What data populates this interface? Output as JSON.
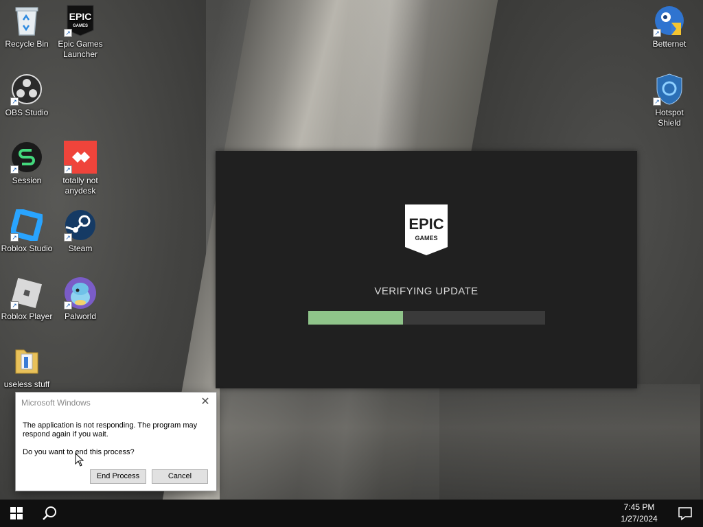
{
  "desktop": {
    "icons_left": [
      {
        "label": "Recycle Bin",
        "icon": "recycle-bin-icon"
      },
      {
        "label": "Epic Games Launcher",
        "icon": "epic-games-icon"
      },
      {
        "label": "OBS Studio",
        "icon": "obs-icon"
      },
      {
        "label": "Session",
        "icon": "session-icon"
      },
      {
        "label": "totally not anydesk",
        "icon": "anydesk-icon"
      },
      {
        "label": "Roblox Studio",
        "icon": "roblox-studio-icon"
      },
      {
        "label": "Steam",
        "icon": "steam-icon"
      },
      {
        "label": "Roblox Player",
        "icon": "roblox-player-icon"
      },
      {
        "label": "Palworld",
        "icon": "palworld-icon"
      },
      {
        "label": "useless stuff",
        "icon": "folder-icon"
      }
    ],
    "icons_right": [
      {
        "label": "Betternet",
        "icon": "betternet-icon"
      },
      {
        "label": "Hotspot Shield",
        "icon": "hotspot-shield-icon"
      }
    ]
  },
  "epic_window": {
    "logo_top": "EPIC",
    "logo_bottom": "GAMES",
    "status": "VERIFYING UPDATE",
    "progress": 0.4,
    "progress_color": "#8fc48a"
  },
  "dialog": {
    "title": "Microsoft Windows",
    "message": "The application is not responding. The program may respond again if you wait.",
    "question": "Do you want to end this process?",
    "end_label": "End Process",
    "cancel_label": "Cancel"
  },
  "taskbar": {
    "time": "7:45 PM",
    "date": "1/27/2024"
  }
}
